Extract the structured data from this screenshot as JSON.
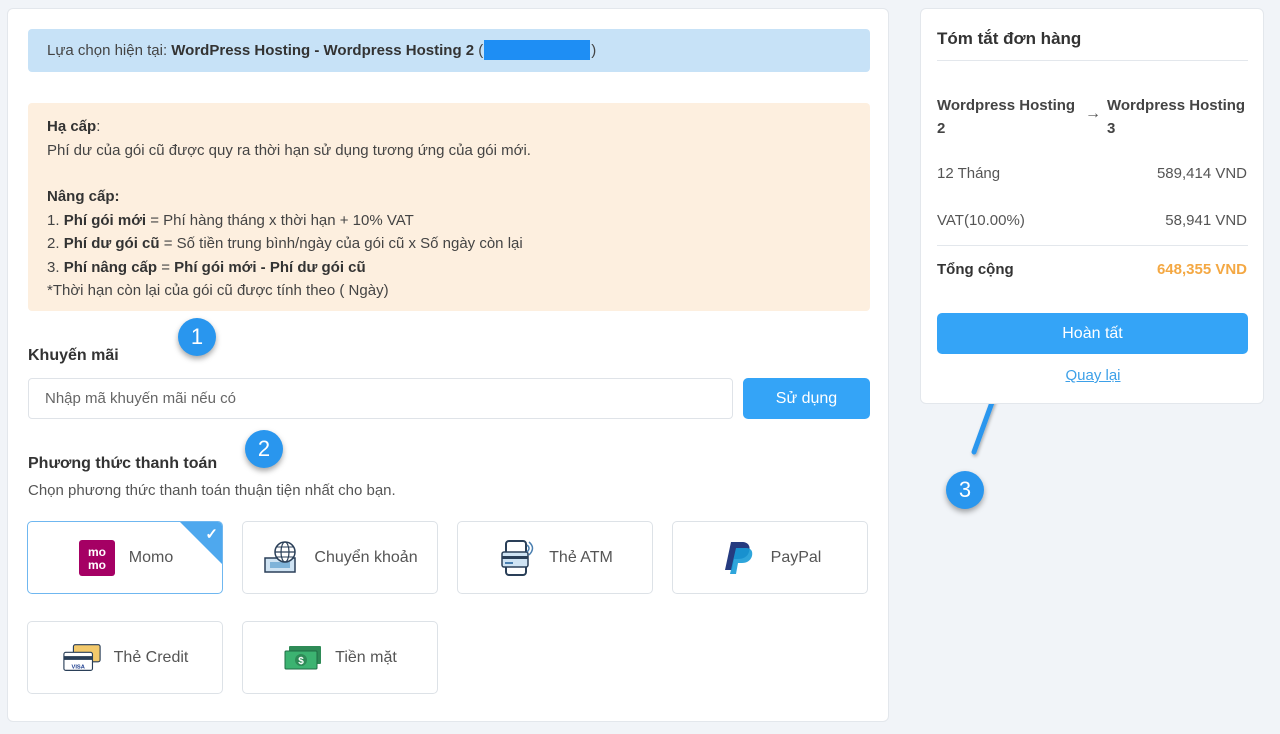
{
  "selection": {
    "label": "Lựa chọn hiện tại:",
    "product": "WordPress Hosting - Wordpress Hosting 2",
    "open_paren": "(",
    "close_paren": ")"
  },
  "info": {
    "downgrade_title": "Hạ cấp",
    "downgrade_colon": ":",
    "downgrade_text": "Phí dư của gói cũ được quy ra thời hạn sử dụng tương ứng của gói mới.",
    "upgrade_title": "Nâng cấp:",
    "line1_prefix": "1. ",
    "line1_bold": "Phí gói mới",
    "line1_rest": " = Phí hàng tháng x thời hạn + 10% VAT",
    "line2_prefix": "2. ",
    "line2_bold": "Phí dư gói cũ",
    "line2_rest": " = Số tiền trung bình/ngày của gói cũ x Số ngày còn lại",
    "line3_prefix": "3. ",
    "line3_bold": "Phí nâng cấp",
    "line3_eq": " = ",
    "line3_bold2": "Phí gói mới - Phí dư gói cũ",
    "note": "*Thời hạn còn lại của gói cũ được tính theo ( Ngày)"
  },
  "promo": {
    "title": "Khuyến mãi",
    "placeholder": "Nhập mã khuyến mãi nếu có",
    "button": "Sử dụng"
  },
  "payment": {
    "title": "Phương thức thanh toán",
    "subtitle": "Chọn phương thức thanh toán thuận tiện nhất cho bạn.",
    "options": [
      {
        "label": "Momo",
        "icon": "momo-icon",
        "selected": true
      },
      {
        "label": "Chuyển khoản",
        "icon": "bank-transfer-icon",
        "selected": false
      },
      {
        "label": "Thẻ ATM",
        "icon": "atm-card-icon",
        "selected": false
      },
      {
        "label": "PayPal",
        "icon": "paypal-icon",
        "selected": false
      },
      {
        "label": "Thẻ Credit",
        "icon": "credit-card-icon",
        "selected": false
      },
      {
        "label": "Tiền mặt",
        "icon": "cash-icon",
        "selected": false
      }
    ],
    "check": "✓"
  },
  "badges": {
    "one": "1",
    "two": "2",
    "three": "3"
  },
  "summary": {
    "title": "Tóm tắt đơn hàng",
    "plan_from": "Wordpress Hosting 2",
    "plan_to": "Wordpress Hosting 3",
    "arrow": "→",
    "rows": [
      {
        "label": "12 Tháng",
        "value": "589,414 VND"
      },
      {
        "label": "VAT(10.00%)",
        "value": "58,941 VND"
      }
    ],
    "total_label": "Tổng cộng",
    "total_value": "648,355 VND",
    "finish_button": "Hoàn tất",
    "back_link": "Quay lại"
  },
  "colors": {
    "accent": "#34a4f7",
    "total": "#f4a843",
    "info_bg": "#fdefdf",
    "selection_bg": "#c7e2f7",
    "momo": "#a50064"
  }
}
